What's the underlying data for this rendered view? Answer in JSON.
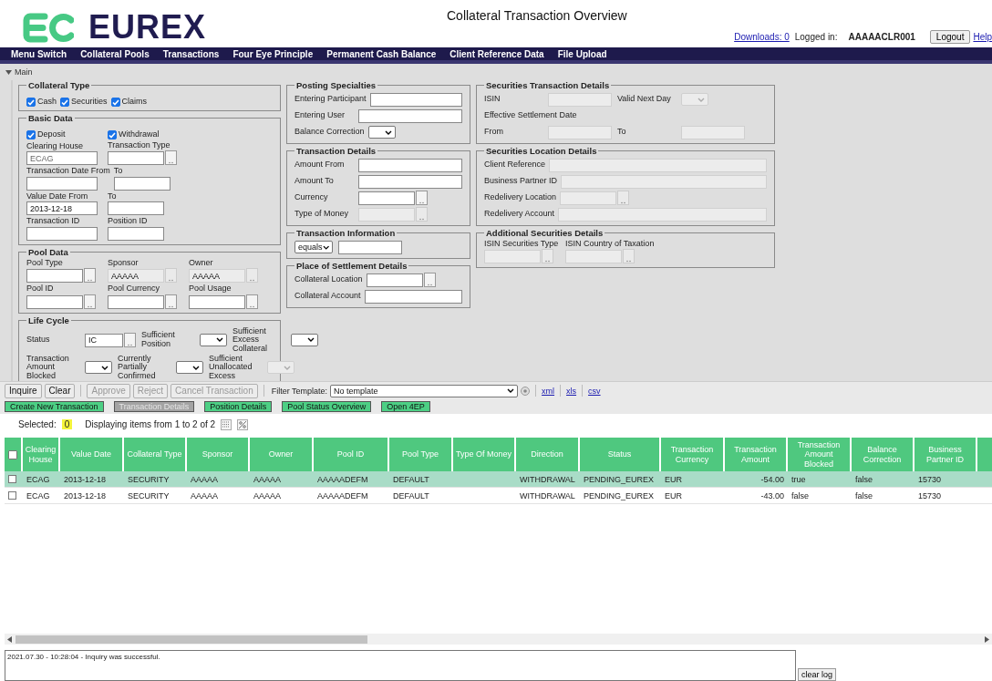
{
  "header": {
    "logo_text": "EUREX",
    "title": "Collateral Transaction Overview",
    "downloads": "Downloads: 0",
    "logged_in_label": "Logged in:",
    "user": "AAAAACLR001",
    "logout": "Logout",
    "help": "Help"
  },
  "menu": [
    "Menu Switch",
    "Collateral Pools",
    "Transactions",
    "Four Eye Principle",
    "Permanent Cash Balance",
    "Client Reference Data",
    "File Upload"
  ],
  "section": {
    "title": "Main",
    "expanded": true
  },
  "columns": [
    [
      {
        "title": "Collateral Type",
        "kind": "stacked",
        "rows": [
          [
            {
              "kind": "checkbox",
              "label": "Cash",
              "checked": true
            },
            {
              "kind": "checkbox",
              "label": "Securities",
              "checked": true
            },
            {
              "kind": "checkbox",
              "label": "Claims",
              "checked": true
            }
          ]
        ]
      },
      {
        "title": "Basic Data",
        "kind": "stacked",
        "rows": [
          [
            {
              "kind": "checkbox",
              "label": "Deposit",
              "checked": true
            },
            {
              "kind": "checkbox",
              "label": "Withdrawal",
              "checked": true
            }
          ],
          [
            {
              "kind": "input",
              "label": "Clearing House",
              "value": "ECAG",
              "readonly": true
            },
            {
              "kind": "lookup",
              "label": "Transaction Type"
            }
          ],
          [
            {
              "kind": "input",
              "label": "Transaction Date From"
            },
            {
              "kind": "input",
              "label": "To"
            }
          ],
          [
            {
              "kind": "input",
              "label": "Value Date From",
              "value": "2013-12-18"
            },
            {
              "kind": "input",
              "label": "To"
            }
          ],
          [
            {
              "kind": "input",
              "label": "Transaction ID"
            },
            {
              "kind": "input",
              "label": "Position ID"
            }
          ]
        ]
      },
      {
        "title": "Pool Data",
        "kind": "stacked",
        "rows": [
          [
            {
              "kind": "lookup",
              "label": "Pool Type"
            },
            {
              "kind": "lookup",
              "label": "Sponsor",
              "value": "AAAAA",
              "disabled": true
            },
            {
              "kind": "lookup",
              "label": "Owner",
              "value": "AAAAA",
              "disabled": true
            }
          ],
          [
            {
              "kind": "lookup",
              "label": "Pool ID"
            },
            {
              "kind": "lookup",
              "label": "Pool Currency"
            },
            {
              "kind": "lookup",
              "label": "Pool Usage"
            }
          ]
        ]
      },
      {
        "title": "Life Cycle",
        "kind": "compact",
        "rows": [
          [
            {
              "kind": "lookup",
              "label": "Status",
              "value": "IC"
            },
            {
              "kind": "select",
              "label": "Sufficient Position"
            },
            {
              "kind": "select",
              "label": "Sufficient Excess Collateral"
            }
          ],
          [
            {
              "kind": "select",
              "label": "Transaction Amount Blocked"
            },
            {
              "kind": "select",
              "label": "Currently Partially Confirmed"
            },
            {
              "kind": "select",
              "label": "Sufficient Unallocated Excess",
              "disabled": true
            }
          ]
        ]
      }
    ],
    [
      {
        "title": "Posting Specialties",
        "kind": "inline",
        "rows": [
          [
            {
              "kind": "input",
              "label": "Entering Participant"
            }
          ],
          [
            {
              "kind": "input",
              "label": "Entering User"
            }
          ],
          [
            {
              "kind": "select",
              "label": "Balance Correction"
            }
          ]
        ]
      },
      {
        "title": "Transaction Details",
        "kind": "inline",
        "rows": [
          [
            {
              "kind": "input",
              "label": "Amount From"
            }
          ],
          [
            {
              "kind": "input",
              "label": "Amount To"
            }
          ],
          [
            {
              "kind": "lookup",
              "label": "Currency"
            }
          ],
          [
            {
              "kind": "lookup",
              "label": "Type of Money",
              "disabled": true
            }
          ]
        ]
      },
      {
        "title": "Transaction Information",
        "kind": "inline",
        "rows": [
          [
            {
              "kind": "select",
              "value": "equals"
            },
            {
              "kind": "input"
            }
          ]
        ]
      },
      {
        "title": "Place of Settlement Details",
        "kind": "inline",
        "rows": [
          [
            {
              "kind": "lookup",
              "label": "Collateral Location"
            }
          ],
          [
            {
              "kind": "input",
              "label": "Collateral Account"
            }
          ]
        ]
      }
    ],
    [
      {
        "title": "Securities Transaction Details",
        "kind": "inline",
        "rows": [
          [
            {
              "kind": "input",
              "label": "ISIN",
              "disabled": true
            },
            {
              "kind": "select",
              "label": "Valid Next Day",
              "disabled": true
            }
          ],
          [
            {
              "kind": "note",
              "label": "Effective Settlement Date"
            }
          ],
          [
            {
              "kind": "input",
              "label": "From",
              "disabled": true
            },
            {
              "kind": "input",
              "label": "To",
              "disabled": true
            }
          ]
        ]
      },
      {
        "title": "Securities Location Details",
        "kind": "inline",
        "rows": [
          [
            {
              "kind": "input",
              "label": "Client Reference",
              "disabled": true
            }
          ],
          [
            {
              "kind": "input",
              "label": "Business Partner ID",
              "disabled": true
            }
          ],
          [
            {
              "kind": "lookup",
              "label": "Redelivery Location",
              "disabled": true
            }
          ],
          [
            {
              "kind": "input",
              "label": "Redelivery Account",
              "disabled": true
            }
          ]
        ]
      },
      {
        "title": "Additional Securities Details",
        "kind": "stacked",
        "rows": [
          [
            {
              "kind": "lookup",
              "label": "ISIN Securities Type",
              "disabled": true
            },
            {
              "kind": "lookup",
              "label": "ISIN Country of Taxation",
              "disabled": true
            }
          ]
        ]
      }
    ]
  ],
  "toolbar": {
    "buttons": [
      {
        "label": "Inquire",
        "disabled": false
      },
      {
        "label": "Clear",
        "disabled": false
      },
      {
        "label": "Approve",
        "disabled": true
      },
      {
        "label": "Reject",
        "disabled": true
      },
      {
        "label": "Cancel Transaction",
        "disabled": true
      }
    ],
    "filter_label": "Filter Template:",
    "filter_value": "No template",
    "links": [
      "xml",
      "xls",
      "csv"
    ]
  },
  "actions": [
    {
      "label": "Create New Transaction",
      "disabled": false
    },
    {
      "label": "Transaction Details",
      "disabled": true
    },
    {
      "label": "Position Details",
      "disabled": false
    },
    {
      "label": "Pool Status Overview",
      "disabled": false
    },
    {
      "label": "Open 4EP",
      "disabled": false
    }
  ],
  "selection": {
    "label": "Selected:",
    "count": "0",
    "info": "Displaying items from 1 to 2 of 2"
  },
  "table": {
    "select_all": {
      "checked": false
    },
    "columns": [
      {
        "label": "Clearing House"
      },
      {
        "label": "Value Date"
      },
      {
        "label": "Collateral Type"
      },
      {
        "label": "Sponsor"
      },
      {
        "label": "Owner"
      },
      {
        "label": "Pool ID"
      },
      {
        "label": "Pool Type"
      },
      {
        "label": "Type Of Money"
      },
      {
        "label": "Direction"
      },
      {
        "label": "Status"
      },
      {
        "label": "Transaction Currency"
      },
      {
        "label": "Transaction Amount",
        "kind": "number"
      },
      {
        "label": "Transaction Amount Blocked"
      },
      {
        "label": "Balance Correction"
      },
      {
        "label": "Business Partner ID"
      }
    ],
    "rows": [
      {
        "highlighted": true,
        "checked": false,
        "cells": [
          "ECAG",
          "2013-12-18",
          "SECURITY",
          "AAAAA",
          "AAAAA",
          "AAAAADEFM",
          "DEFAULT",
          null,
          "WITHDRAWAL",
          "PENDING_EUREX",
          "EUR",
          "-54.00",
          "true",
          "false",
          "15730"
        ]
      },
      {
        "highlighted": false,
        "checked": false,
        "cells": [
          "ECAG",
          "2013-12-18",
          "SECURITY",
          "AAAAA",
          "AAAAA",
          "AAAAADEFM",
          "DEFAULT",
          null,
          "WITHDRAWAL",
          "PENDING_EUREX",
          "EUR",
          "-43.00",
          "false",
          "false",
          "15730"
        ]
      }
    ]
  },
  "log": {
    "message": "2021.07.30 - 10:28:04 - Inquiry was successful.",
    "clear": "clear log"
  }
}
